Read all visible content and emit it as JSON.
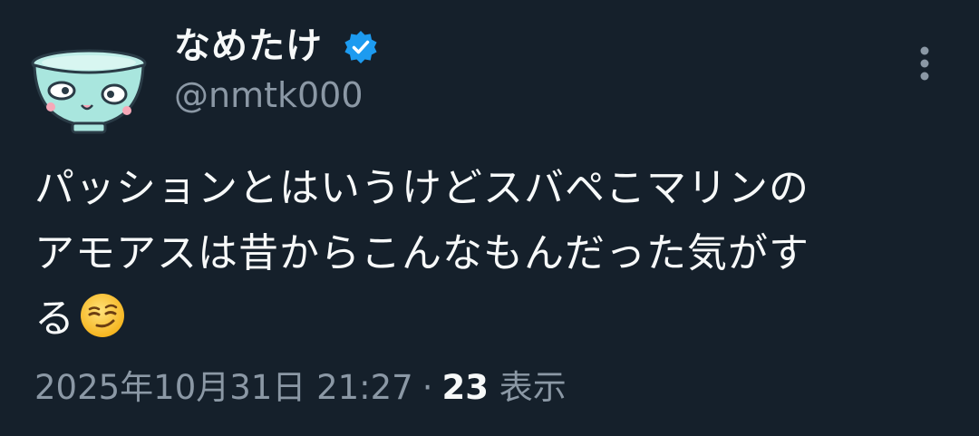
{
  "author": {
    "display_name": "なめたけ",
    "handle": "@nmtk000",
    "verified": true,
    "avatar_icon": "rice-bowl-character-avatar"
  },
  "tweet": {
    "text_lines": [
      "パッションとはいうけどスバペこマリンの",
      "アモアスは昔からこんなもんだった気がす",
      "る"
    ],
    "emoji": "smirking-face-emoji"
  },
  "meta": {
    "timestamp": "2025年10月31日 21:27",
    "separator": "·",
    "views_count": "23",
    "views_label": "表示"
  },
  "colors": {
    "background": "#15202b",
    "text_primary": "#f7f9f9",
    "text_secondary": "#8b98a5",
    "verified_blue": "#1d9bf0"
  },
  "menu": {
    "icon": "more-vertical-icon"
  }
}
